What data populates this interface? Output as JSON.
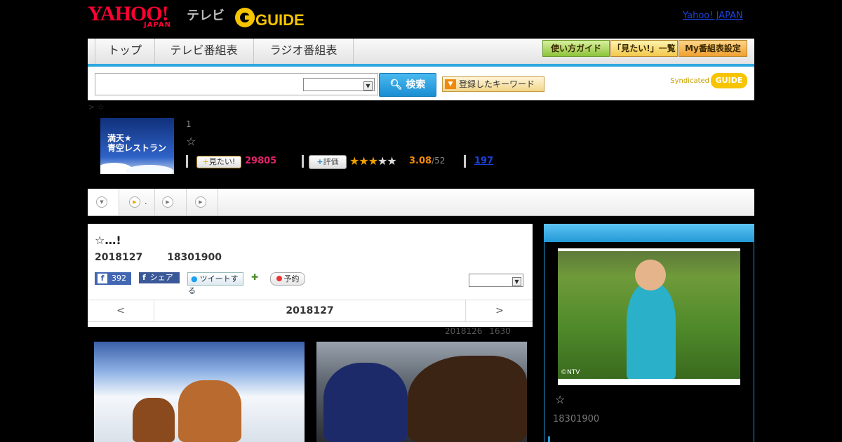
{
  "header": {
    "yahoo_logo": "YAHOO!",
    "yahoo_sub": "JAPAN",
    "tv_label": "テレビ",
    "gguide_logo": "GUIDE",
    "yahoo_japan_link": "Yahoo! JAPAN"
  },
  "nav": {
    "tabs": [
      "トップ",
      "テレビ番組表",
      "ラジオ番組表"
    ],
    "buttons": [
      "使い方ガイド",
      "「見たい!」一覧",
      "My番組表設定"
    ]
  },
  "search": {
    "input_value": "",
    "select_value": "",
    "button_label": "検索",
    "keyword_button": "登録したキーワード",
    "syndicated_label": "Syndicated",
    "syndicated_logo": "GUIDE"
  },
  "breadcrumb": "> ☆",
  "program": {
    "thumb_text_line1": "満天★",
    "thumb_text_line2": "青空レストラン",
    "episode": "1",
    "star": "☆",
    "want_label": "見たい!",
    "want_count": "29805",
    "rate_label": "評価",
    "rating_value": "3.08",
    "rating_total": "/52",
    "rating_stars": 3,
    "review_count": "197"
  },
  "subtabs": [
    {
      "label": ""
    },
    {
      "label": "."
    },
    {
      "label": ""
    },
    {
      "label": ""
    }
  ],
  "detail": {
    "title": "☆…!",
    "date": "2018127",
    "time": "18301900",
    "fb_like_count": "392",
    "fb_share": "シェア",
    "tweet": "ツイートする",
    "reserve": "予約",
    "select_value": "",
    "prev": "<",
    "current_date": "2018127",
    "next": ">",
    "updated_date": "2018126",
    "updated_time": "1630"
  },
  "side": {
    "photo_credit": "©NTV",
    "star": "☆",
    "time": "18301900"
  },
  "colors": {
    "accent_blue": "#2ea7e0",
    "want_pink": "#e0226a",
    "rating_orange": "#f08a0c"
  }
}
